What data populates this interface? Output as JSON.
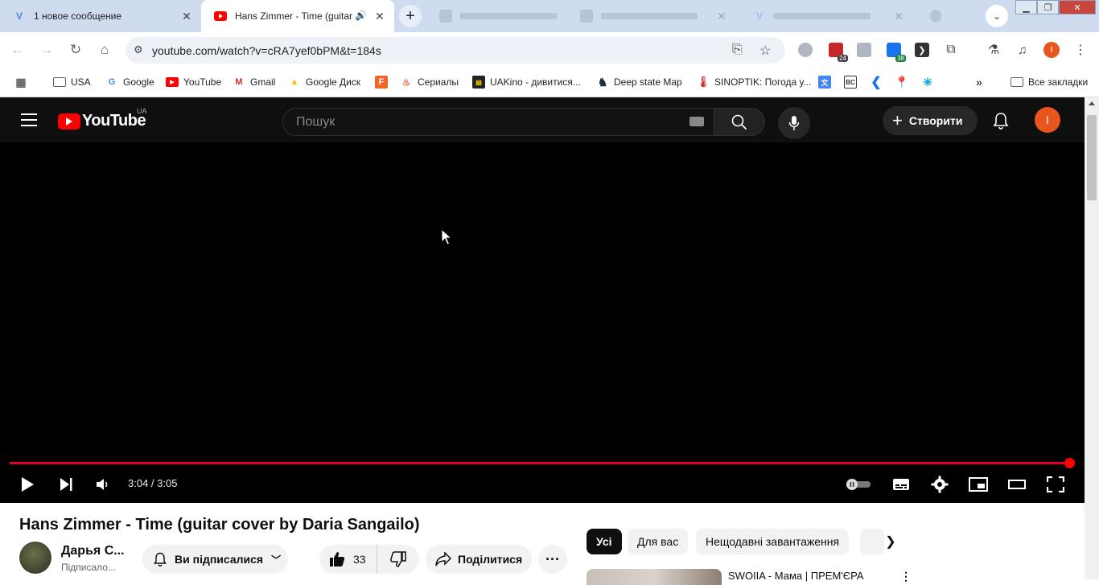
{
  "browser": {
    "tabs": [
      {
        "title": "1 новое сообщение",
        "favicon": "V"
      },
      {
        "title": "Hans Zimmer - Time (guitar c",
        "favicon": "yt"
      },
      {
        "title": "",
        "favicon": "faded"
      },
      {
        "title": "",
        "favicon": "faded"
      },
      {
        "title": "",
        "favicon": "faded"
      }
    ],
    "new_tab_label": "+",
    "url": "youtube.com/watch?v=cRA7yef0bPM&t=184s",
    "extension_badges": [
      "24",
      "38"
    ],
    "profile_initial": "I",
    "accent": "#cfdcef"
  },
  "bookmarks": [
    {
      "label": "USA",
      "icon": "folder-icon"
    },
    {
      "label": "Google",
      "icon": "google-icon"
    },
    {
      "label": "YouTube",
      "icon": "youtube-icon"
    },
    {
      "label": "Gmail",
      "icon": "gmail-icon"
    },
    {
      "label": "Google Диск",
      "icon": "drive-icon"
    },
    {
      "label": "",
      "icon": "f-icon"
    },
    {
      "label": "Сериалы",
      "icon": "fire-icon"
    },
    {
      "label": "UAKino - дивитися...",
      "icon": "uakino-icon"
    },
    {
      "label": "Deep state Map",
      "icon": "knight-icon"
    },
    {
      "label": "SINOPTIK: Погода у...",
      "icon": "thermometer-icon"
    },
    {
      "label": "Все закладки",
      "icon": "folder-icon"
    }
  ],
  "youtube": {
    "logo_text": "YouTube",
    "country_code": "UA",
    "search_placeholder": "Пошук",
    "create_label": "Створити",
    "avatar_initial": "I",
    "brand_red": "#ff0000"
  },
  "player": {
    "time_display": "3:04 / 3:05",
    "progress_fraction": 0.995
  },
  "video": {
    "title": "Hans Zimmer - Time (guitar cover by Daria Sangailo)",
    "channel_name": "Дарья С...",
    "channel_subs": "Підписало...",
    "subscribed_label": "Ви підписалися",
    "likes": "33",
    "share_label": "Поділитися"
  },
  "chips": [
    "Усі",
    "Для вас",
    "Нещодавні завантаження"
  ],
  "recommendation": {
    "title": "SWOIIA - Мама | ПРЕМ'ЄРА"
  }
}
